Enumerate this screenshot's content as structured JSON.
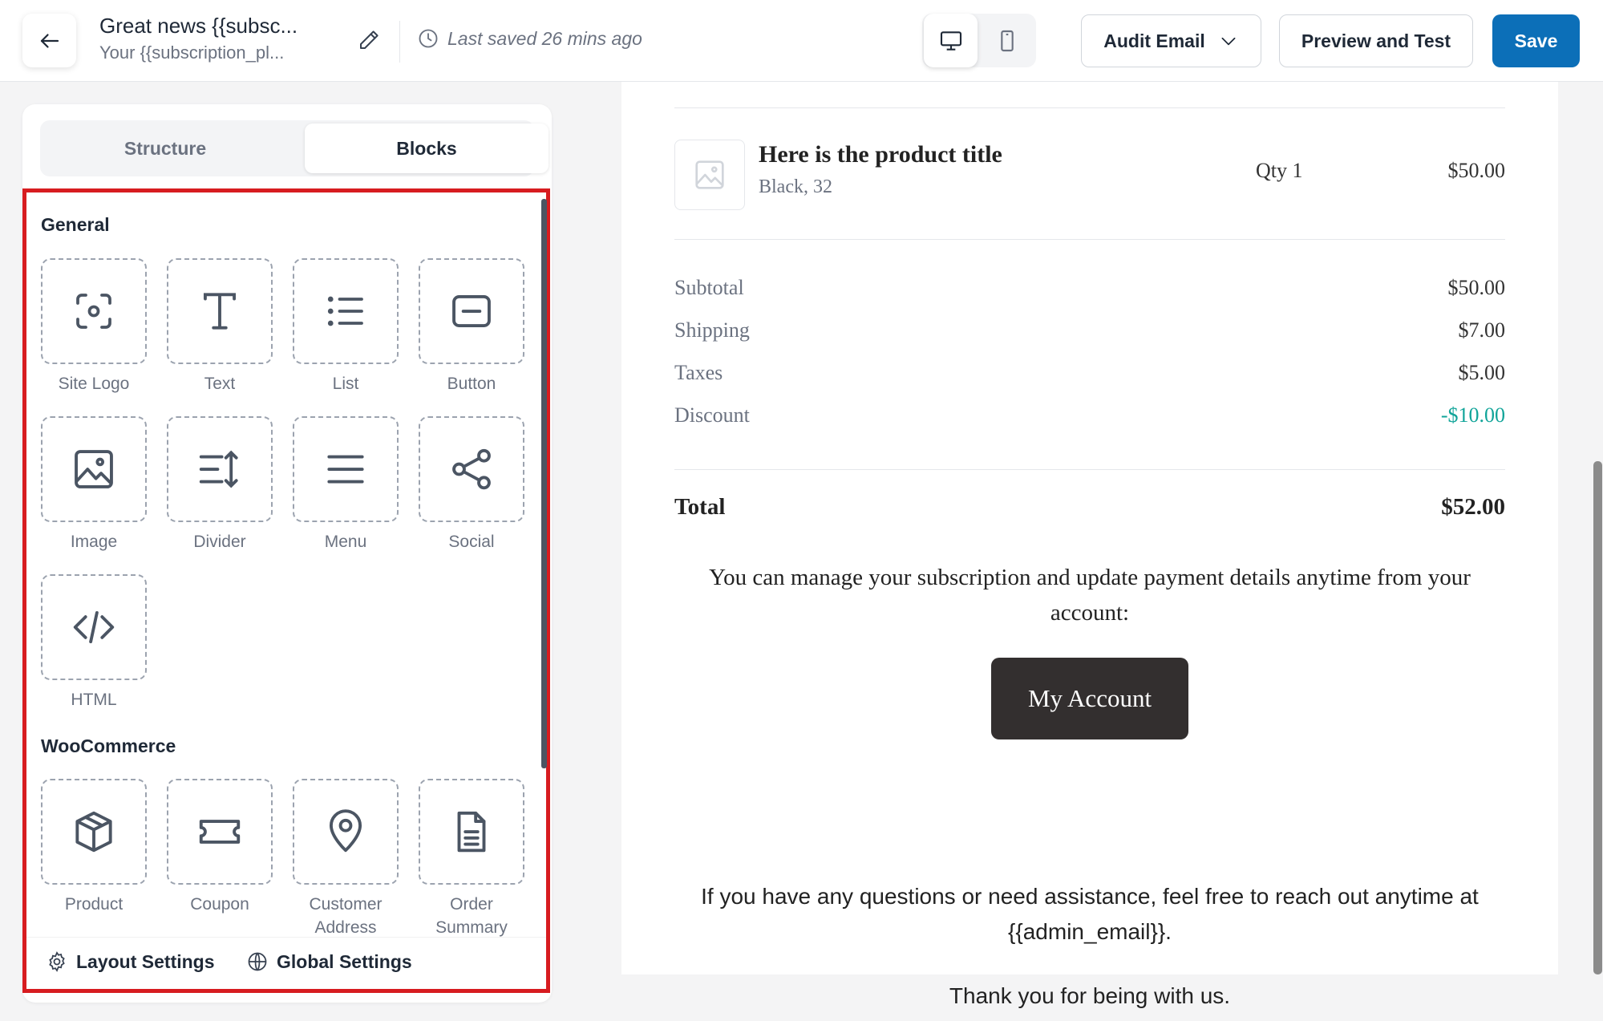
{
  "header": {
    "title": "Great news {{subsc...",
    "subtitle": "Your {{subscription_pl...",
    "last_saved": "Last saved 26 mins ago",
    "audit_label": "Audit Email",
    "preview_label": "Preview and Test",
    "save_label": "Save",
    "icons": [
      "arrow-left-icon",
      "pencil-icon",
      "clock-icon",
      "desktop-icon",
      "mobile-icon",
      "chevron-down-icon"
    ]
  },
  "colors": {
    "primary": "#0c6fb8",
    "highlight": "#d71c20",
    "discount": "#10a499",
    "dark_button": "#332f2f"
  },
  "panel": {
    "tabs": [
      {
        "label": "Structure",
        "active": false
      },
      {
        "label": "Blocks",
        "active": true
      }
    ],
    "general_title": "General",
    "general_blocks": [
      {
        "label": "Site Logo",
        "icon": "site-logo-icon"
      },
      {
        "label": "Text",
        "icon": "text-icon"
      },
      {
        "label": "List",
        "icon": "list-icon"
      },
      {
        "label": "Button",
        "icon": "button-icon"
      },
      {
        "label": "Image",
        "icon": "image-icon"
      },
      {
        "label": "Divider",
        "icon": "divider-icon"
      },
      {
        "label": "Menu",
        "icon": "menu-icon"
      },
      {
        "label": "Social",
        "icon": "share-icon"
      },
      {
        "label": "HTML",
        "icon": "code-icon"
      }
    ],
    "woocommerce_title": "WooCommerce",
    "woocommerce_blocks": [
      {
        "label": "Product",
        "icon": "box-icon"
      },
      {
        "label": "Coupon",
        "icon": "ticket-icon"
      },
      {
        "label": "Customer Address",
        "icon": "map-pin-icon"
      },
      {
        "label": "Order Summary",
        "icon": "document-icon"
      }
    ],
    "footer": {
      "layout_settings": "Layout Settings",
      "global_settings": "Global Settings"
    }
  },
  "email": {
    "product": {
      "title": "Here is the product title",
      "variant": "Black, 32",
      "qty": "Qty 1",
      "price": "$50.00"
    },
    "summary": [
      {
        "label": "Subtotal",
        "value": "$50.00"
      },
      {
        "label": "Shipping",
        "value": "$7.00"
      },
      {
        "label": "Taxes",
        "value": "$5.00"
      },
      {
        "label": "Discount",
        "value": "-$10.00"
      }
    ],
    "total_label": "Total",
    "total_value": "$52.00",
    "manage_text": "You can manage your subscription and update payment details anytime from your account:",
    "account_button": "My Account",
    "help_text": "If you have any questions or need assistance, feel free to reach out anytime at {{admin_email}}.",
    "thanks_text": "Thank you for being with us."
  }
}
